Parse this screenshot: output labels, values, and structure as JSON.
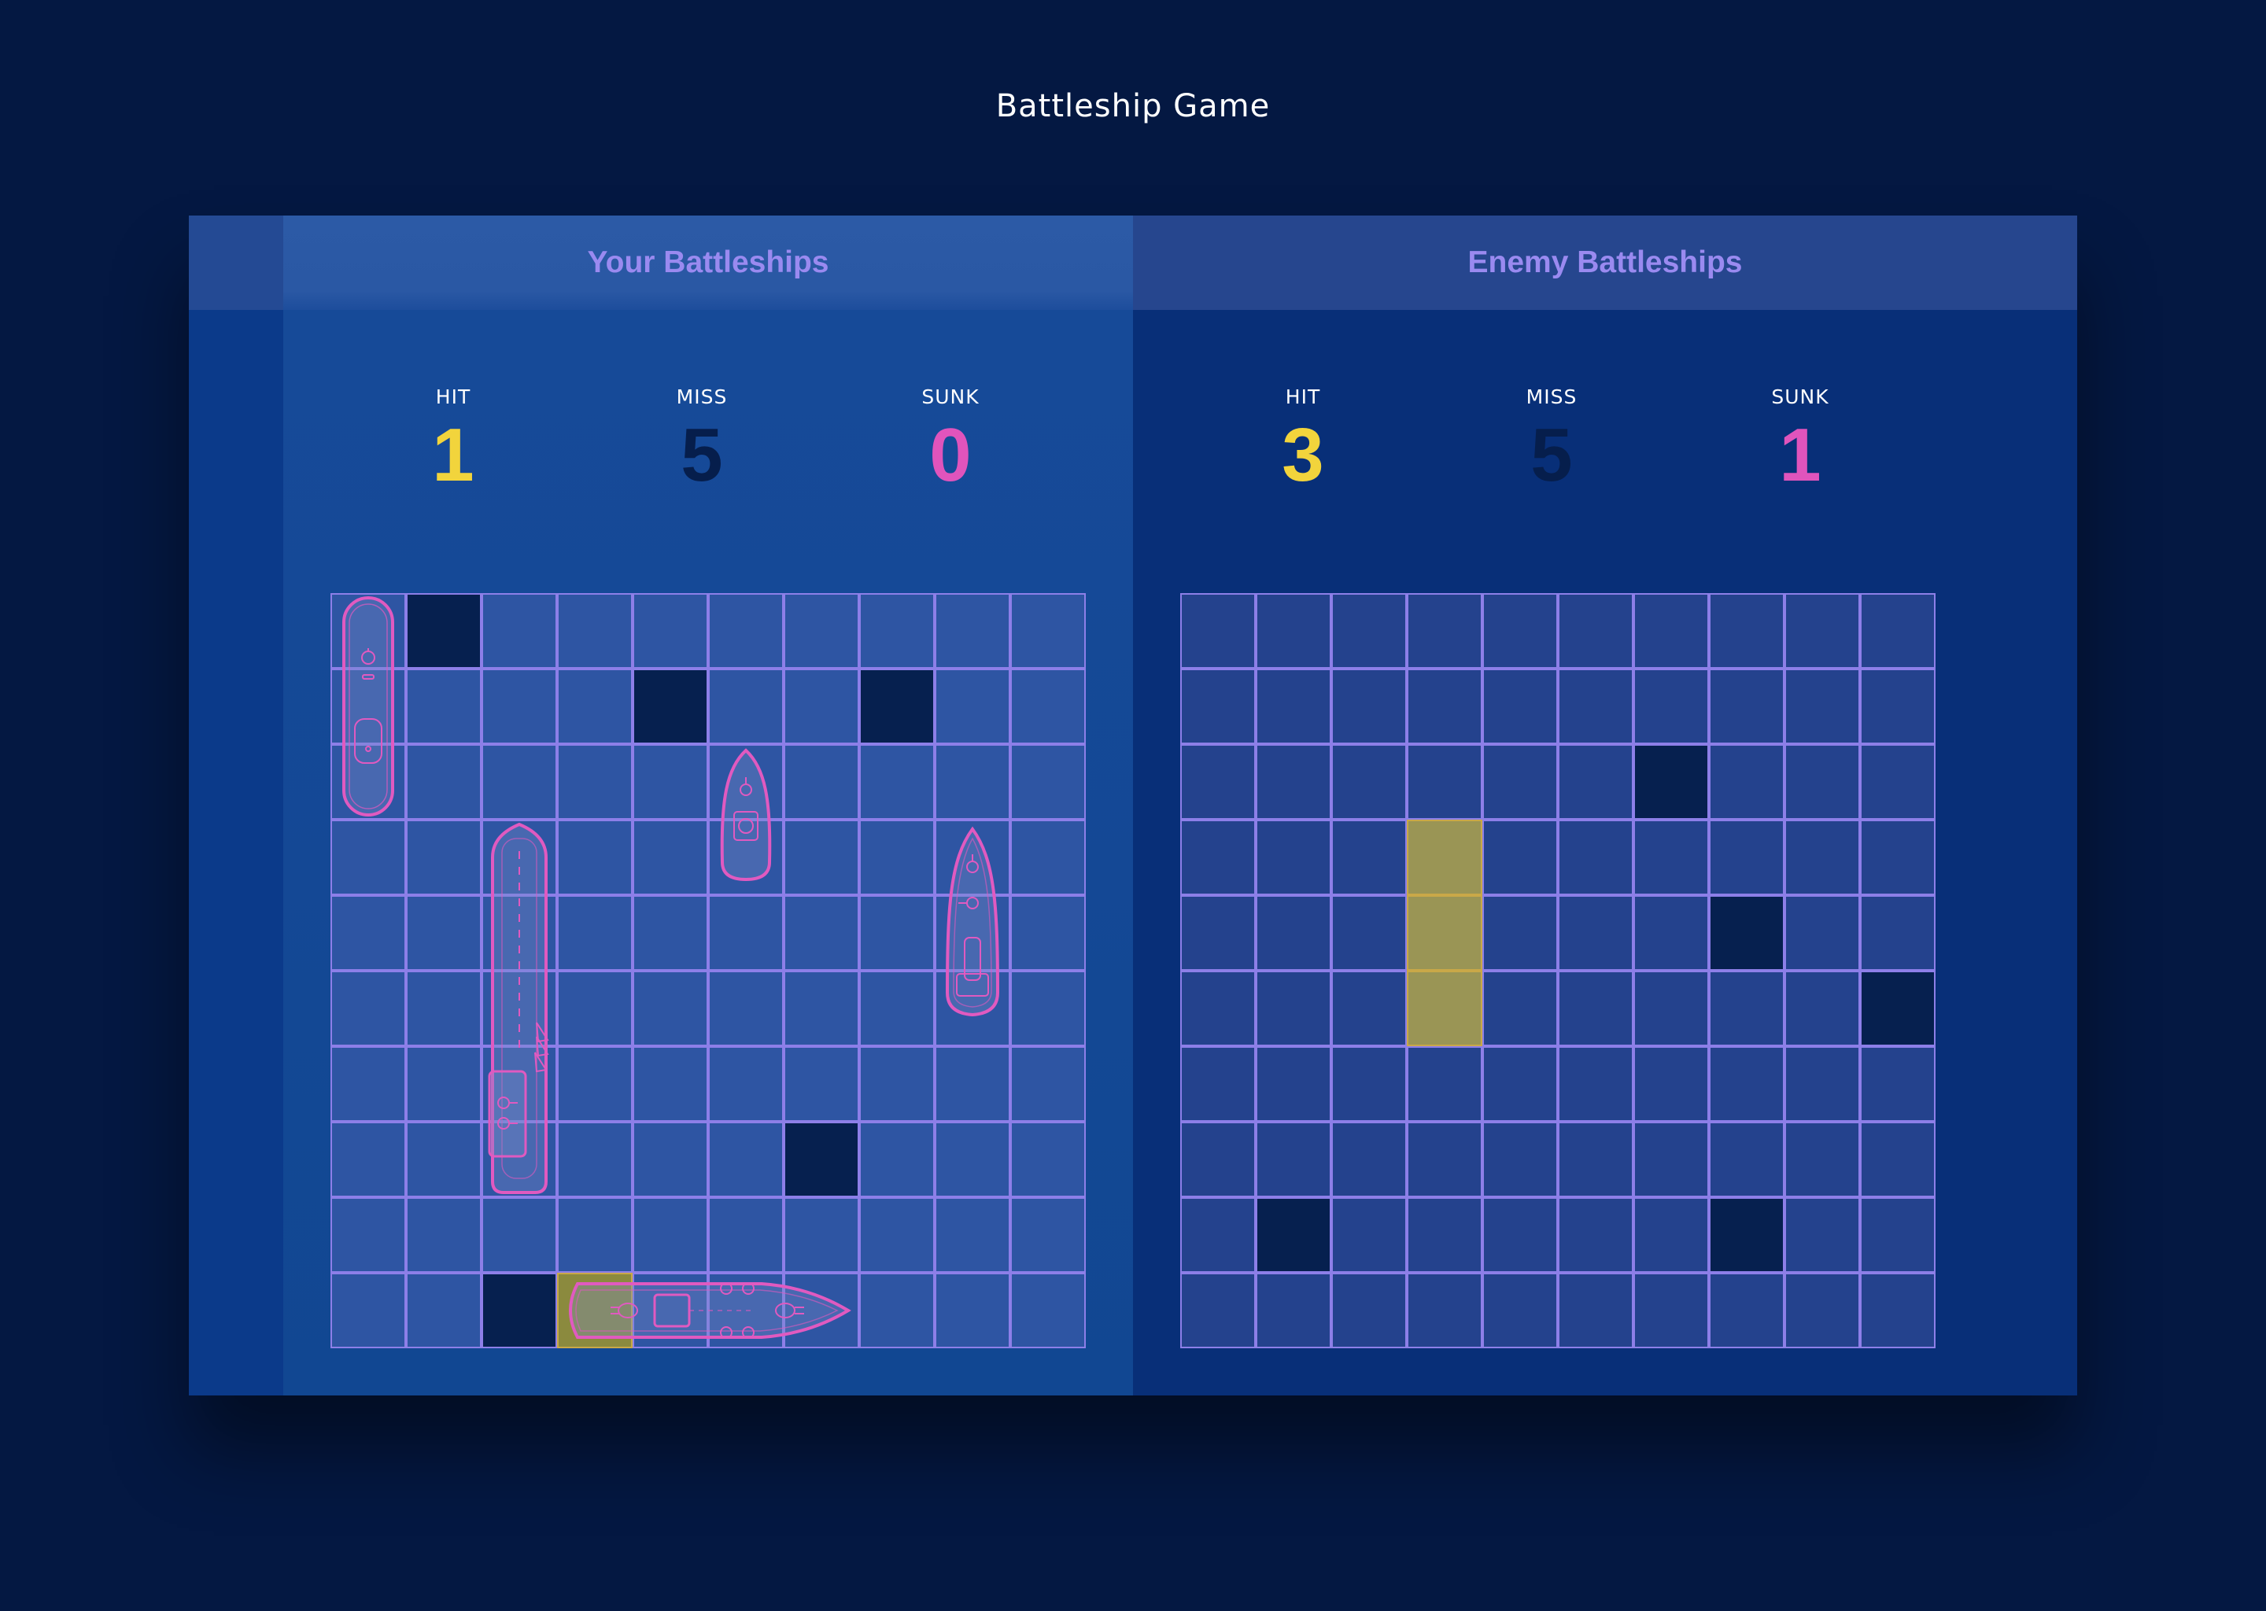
{
  "app": {
    "title": "Battleship Game"
  },
  "colors": {
    "hit": "#f2d43c",
    "miss": "#061e4c",
    "sunk": "#e054bc",
    "ship_outline": "#e05ac0",
    "grid_line": "#8d7fe8",
    "header_text": "#9a8af0"
  },
  "player": {
    "header": "Your Battleships",
    "stats": {
      "hit_label": "HIT",
      "hit": "1",
      "miss_label": "MISS",
      "miss": "5",
      "sunk_label": "SUNK",
      "sunk": "0"
    },
    "misses": [
      [
        0,
        1
      ],
      [
        1,
        4
      ],
      [
        1,
        7
      ],
      [
        7,
        6
      ],
      [
        9,
        2
      ]
    ],
    "hits": [
      [
        9,
        3
      ]
    ],
    "ships": [
      {
        "name": "patrol-boat",
        "row": 0,
        "col": 0,
        "length": 3,
        "orientation": "vertical",
        "icon": "patrol-ship-icon"
      },
      {
        "name": "submarine",
        "row": 2,
        "col": 5,
        "length": 2,
        "orientation": "vertical",
        "icon": "submarine-ship-icon"
      },
      {
        "name": "carrier",
        "row": 3,
        "col": 2,
        "length": 5,
        "orientation": "vertical",
        "icon": "aircraft-carrier-icon"
      },
      {
        "name": "destroyer",
        "row": 3,
        "col": 8,
        "length": 3,
        "orientation": "vertical",
        "icon": "destroyer-ship-icon"
      },
      {
        "name": "battleship",
        "row": 9,
        "col": 3,
        "length": 4,
        "orientation": "horizontal",
        "icon": "battleship-icon"
      }
    ]
  },
  "enemy": {
    "header": "Enemy Battleships",
    "stats": {
      "hit_label": "HIT",
      "hit": "3",
      "miss_label": "MISS",
      "miss": "5",
      "sunk_label": "SUNK",
      "sunk": "1"
    },
    "misses": [
      [
        2,
        6
      ],
      [
        4,
        7
      ],
      [
        5,
        9
      ],
      [
        8,
        1
      ],
      [
        8,
        7
      ]
    ],
    "hits": [
      [
        3,
        3
      ],
      [
        4,
        3
      ],
      [
        5,
        3
      ]
    ]
  }
}
